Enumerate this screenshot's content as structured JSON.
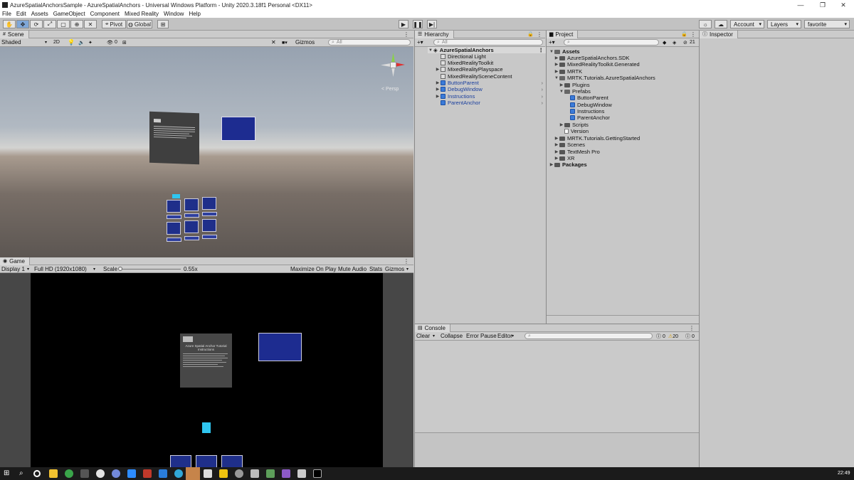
{
  "window": {
    "title": "AzureSpatialAnchorsSample - AzureSpatialAnchors - Universal Windows Platform - Unity 2020.3.18f1 Personal <DX11>"
  },
  "menu": [
    "File",
    "Edit",
    "Assets",
    "GameObject",
    "Component",
    "Mixed Reality",
    "Window",
    "Help"
  ],
  "toolbar": {
    "pivot_label": "Pivot",
    "global_label": "Global",
    "account_label": "Account",
    "layers_label": "Layers",
    "layout_label": "favorite"
  },
  "scene": {
    "tab_label": "Scene",
    "shade_mode": "Shaded",
    "mode_2d": "2D",
    "hidden_count": "0",
    "gizmos_label": "Gizmos",
    "search_placeholder": "All",
    "persp_label": "< Persp"
  },
  "game": {
    "tab_label": "Game",
    "display": "Display 1",
    "resolution": "Full HD (1920x1080)",
    "scale_label": "Scale",
    "scale_value": "0.55x",
    "maximize_label": "Maximize On Play",
    "mute_label": "Mute Audio",
    "stats_label": "Stats",
    "gizmos_label": "Gizmos",
    "instructions_title_line1": "Azure Spatial Anchor Tutorial",
    "instructions_title_line2": "Instructions"
  },
  "hierarchy": {
    "tab_label": "Hierarchy",
    "search_placeholder": "All",
    "scene_name": "AzureSpatialAnchors",
    "items": [
      {
        "label": "Directional Light",
        "blue": false,
        "arrow": false
      },
      {
        "label": "MixedRealityToolkit",
        "blue": false,
        "arrow": false
      },
      {
        "label": "MixedRealityPlayspace",
        "blue": false,
        "arrow": true
      },
      {
        "label": "MixedRealitySceneContent",
        "blue": false,
        "arrow": false
      },
      {
        "label": "ButtonParent",
        "blue": true,
        "arrow": true
      },
      {
        "label": "DebugWindow",
        "blue": true,
        "arrow": true
      },
      {
        "label": "Instructions",
        "blue": true,
        "arrow": true
      },
      {
        "label": "ParentAnchor",
        "blue": true,
        "arrow": false
      }
    ]
  },
  "project": {
    "tab_label": "Project",
    "badge_count": "21",
    "items": [
      {
        "label": "Assets",
        "bold": true
      },
      {
        "label": "AzureSpatialAnchors.SDK"
      },
      {
        "label": "MixedRealityToolkit.Generated"
      },
      {
        "label": "MRTK"
      },
      {
        "label": "MRTK.Tutorials.AzureSpatialAnchors"
      },
      {
        "label": "Plugins"
      },
      {
        "label": "Prefabs"
      },
      {
        "label": "ButtonParent"
      },
      {
        "label": "DebugWindow"
      },
      {
        "label": "Instructions"
      },
      {
        "label": "ParentAnchor"
      },
      {
        "label": "Scripts"
      },
      {
        "label": "Version"
      },
      {
        "label": "MRTK.Tutorials.GettingStarted"
      },
      {
        "label": "Scenes"
      },
      {
        "label": "TextMesh Pro"
      },
      {
        "label": "XR"
      },
      {
        "label": "Packages",
        "bold": true
      }
    ]
  },
  "console": {
    "tab_label": "Console",
    "clear_label": "Clear",
    "collapse_label": "Collapse",
    "error_pause_label": "Error Pause",
    "editor_label": "Editor",
    "info_count": "0",
    "warning_count": "20",
    "error_count": "0"
  },
  "inspector": {
    "tab_label": "Inspector"
  },
  "taskbar": {
    "clock": "22:49"
  }
}
